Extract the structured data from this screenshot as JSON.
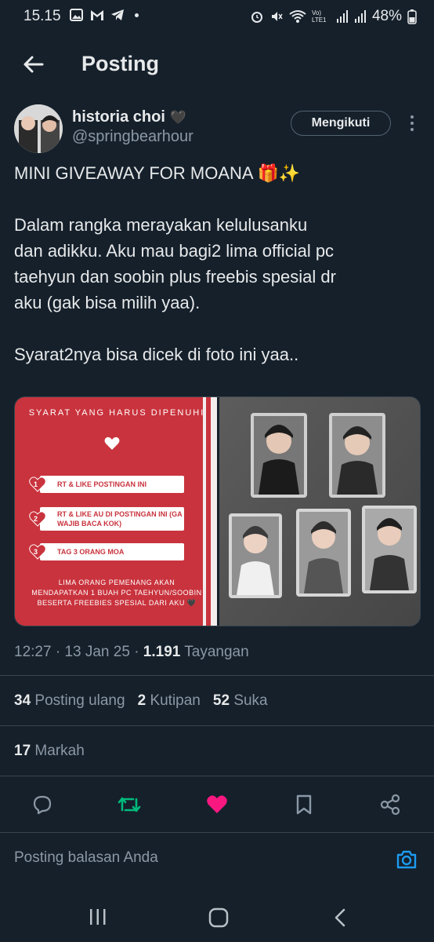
{
  "status_bar": {
    "time": "15.15",
    "battery": "48%",
    "network": "Vo) LTE1"
  },
  "header": {
    "title": "Posting"
  },
  "author": {
    "name": "historia choi",
    "emoji": "🖤",
    "handle": "@springbearhour",
    "follow_label": "Mengikuti"
  },
  "tweet": {
    "text": "MINI GIVEAWAY FOR MOANA 🎁✨\n\nDalam rangka merayakan kelulusanku\ndan adikku. Aku mau bagi2 lima official pc\ntaehyun dan soobin plus freebis spesial dr\naku (gak bisa milih yaa).\n\nSyarat2nya bisa dicek di foto ini yaa.."
  },
  "media": {
    "requirements_title": "SYARAT YANG HARUS DIPENUHI",
    "requirements": [
      {
        "num": "1",
        "text": "RT & LIKE POSTINGAN INI"
      },
      {
        "num": "2",
        "text": "RT & LIKE AU DI POSTINGAN INI (GA WAJIB BACA KOK)"
      },
      {
        "num": "3",
        "text": "TAG 3 ORANG MOA"
      }
    ],
    "footer": "LIMA ORANG PEMENANG AKAN MENDAPATKAN 1 BUAH PC TAEHYUN/SOOBIN BESERTA FREEBIES SPESIAL DARI AKU 🖤"
  },
  "meta": {
    "time": "12:27",
    "date": "13 Jan 25",
    "views_count": "1.191",
    "views_label": "Tayangan"
  },
  "stats": {
    "reposts_count": "34",
    "reposts_label": "Posting ulang",
    "quotes_count": "2",
    "quotes_label": "Kutipan",
    "likes_count": "52",
    "likes_label": "Suka",
    "bookmarks_count": "17",
    "bookmarks_label": "Markah"
  },
  "reply": {
    "placeholder": "Posting balasan Anda"
  },
  "colors": {
    "background": "#15202b",
    "repost_green": "#00ba7c",
    "like_pink": "#f91880",
    "accent_blue": "#1d9bf0",
    "media_red": "#c9333d"
  }
}
